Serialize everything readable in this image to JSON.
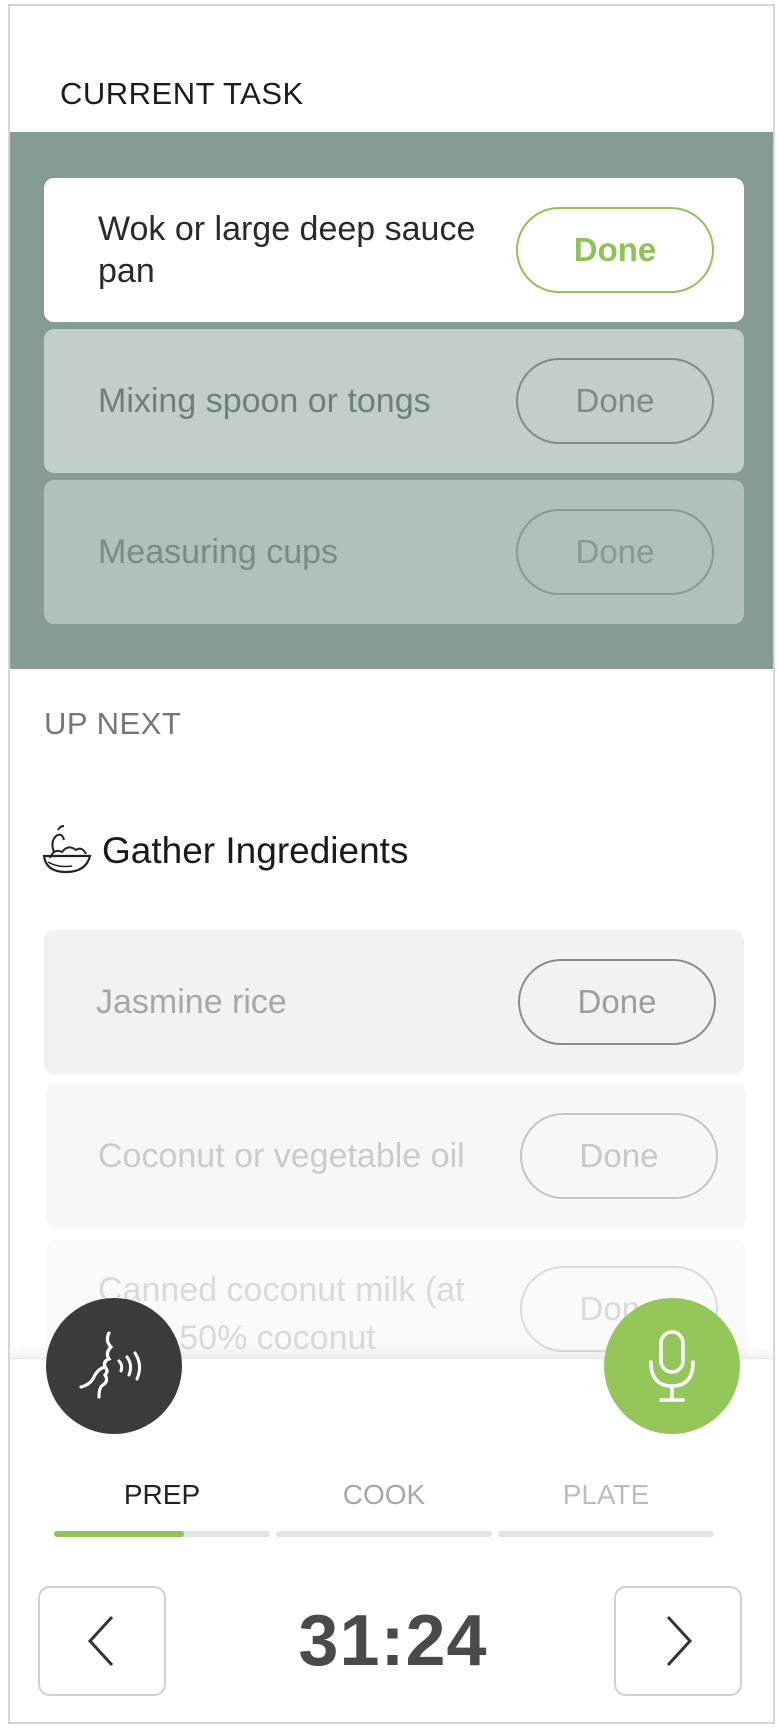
{
  "current_task": {
    "heading": "CURRENT TASK",
    "tasks": [
      {
        "label": "Wok or large deep sauce pan",
        "button": "Done"
      },
      {
        "label": "Mixing spoon or tongs",
        "button": "Done"
      },
      {
        "label": "Measuring cups",
        "button": "Done"
      }
    ]
  },
  "up_next": {
    "heading": "UP NEXT",
    "group_title": "Gather Ingredients",
    "group_icon": "fruit-bowl-icon",
    "items": [
      {
        "label": "Jasmine rice",
        "button": "Done"
      },
      {
        "label": "Coconut or vegetable oil",
        "button": "Done"
      },
      {
        "label": "Canned coconut milk (at least 50% coconut",
        "button": "Done"
      }
    ]
  },
  "fabs": {
    "voice_icon": "voice-speak-icon",
    "mic_icon": "microphone-icon",
    "mic_color": "#94c65a",
    "voice_color": "#3b3b3b"
  },
  "phases": {
    "items": [
      {
        "label": "PREP",
        "progress": 0.6
      },
      {
        "label": "COOK",
        "progress": 0
      },
      {
        "label": "PLATE",
        "progress": 0
      }
    ],
    "accent": "#8dc455"
  },
  "timer": {
    "value": "31:24",
    "prev_icon": "chevron-left-icon",
    "next_icon": "chevron-right-icon"
  }
}
